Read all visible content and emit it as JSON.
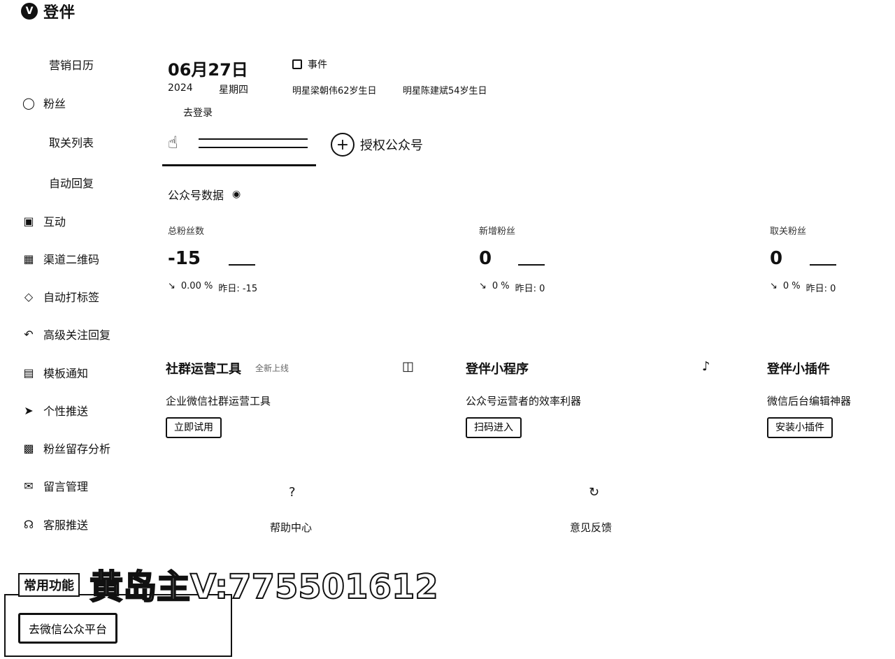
{
  "app": {
    "logo_text": "登伴",
    "logo_mark": "V"
  },
  "sidebar": {
    "items": [
      {
        "label": "营销日历",
        "icon": "",
        "sub": true
      },
      {
        "label": "粉丝",
        "icon": "user-icon",
        "sub": false
      },
      {
        "label": "取关列表",
        "icon": "",
        "sub": true
      },
      {
        "label": "自动回复",
        "icon": "",
        "sub": true
      },
      {
        "label": "互动",
        "icon": "chat-icon",
        "sub": false
      },
      {
        "label": "渠道二维码",
        "icon": "qrcode-icon",
        "sub": false
      },
      {
        "label": "自动打标签",
        "icon": "tag-icon",
        "sub": false
      },
      {
        "label": "高级关注回复",
        "icon": "reply-icon",
        "sub": false
      },
      {
        "label": "模板通知",
        "icon": "template-icon",
        "sub": false
      },
      {
        "label": "个性推送",
        "icon": "send-icon",
        "sub": false
      },
      {
        "label": "粉丝留存分析",
        "icon": "chart-icon",
        "sub": false
      },
      {
        "label": "留言管理",
        "icon": "message-icon",
        "sub": false
      },
      {
        "label": "客服推送",
        "icon": "headset-icon",
        "sub": false
      }
    ]
  },
  "calendar": {
    "date": "06月27日",
    "year": "2024",
    "weekday": "星期四",
    "events_label": "事件",
    "events": [
      "明星梁朝伟62岁生日",
      "明星陈建斌54岁生日"
    ],
    "login_link": "去登录"
  },
  "accounts": {
    "authorize_label": "授权公众号"
  },
  "stats": {
    "title": "公众号数据",
    "items": [
      {
        "label": "总粉丝数",
        "value": "-15",
        "change": "0.00 %",
        "yesterday": "昨日: -15"
      },
      {
        "label": "新增粉丝",
        "value": "0",
        "change": "0 %",
        "yesterday": "昨日: 0"
      },
      {
        "label": "取关粉丝",
        "value": "0",
        "change": "0 %",
        "yesterday": "昨日: 0"
      }
    ]
  },
  "tools": [
    {
      "title": "社群运营工具",
      "tag": "全新上线",
      "desc": "企业微信社群运营工具",
      "button": "立即试用",
      "icon": "book-icon"
    },
    {
      "title": "登伴小程序",
      "tag": "",
      "desc": "公众号运营者的效率利器",
      "button": "扫码进入",
      "icon": "music-icon"
    },
    {
      "title": "登伴小插件",
      "tag": "",
      "desc": "微信后台编辑神器",
      "button": "安装小插件",
      "icon": ""
    }
  ],
  "help": [
    {
      "label": "帮助中心",
      "glyph": "?",
      "icon": "help-icon"
    },
    {
      "label": "意见反馈",
      "glyph": "↻",
      "icon": "feedback-icon"
    }
  ],
  "bottom": {
    "title": "常用功能",
    "button": "去微信公众平台"
  },
  "watermark": "黄岛主V:775501612"
}
